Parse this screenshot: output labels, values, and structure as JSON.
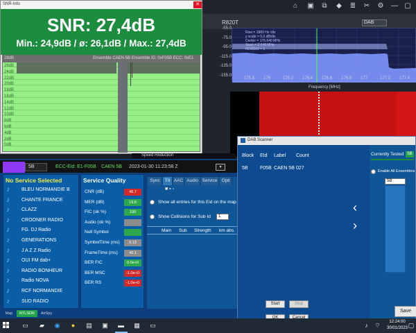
{
  "spectrum_window": {
    "title": "R820T",
    "select_value": "DAB",
    "legend": [
      "Rise = 3983 Hz /div",
      "y scale = 5.0 dB/div",
      "Center = 176.640 MHz",
      "Span = 2.048 MHz",
      "NOMSW = 1"
    ],
    "y_ticks": [
      "-55.0",
      "-75.0",
      "-95.0",
      "-115.0",
      "-135.0",
      "-155.0"
    ],
    "x_ticks": [
      "175.8",
      "176",
      "176.2",
      "176.4",
      "176.6",
      "176.8",
      "177",
      "177.2",
      "177.4"
    ],
    "x_label": "Frequency [MHz]"
  },
  "snr_window": {
    "title": "SNR-Info",
    "close": "✕",
    "snr_text": "SNR: 27,4dB",
    "stats_text": "Min.: 24,9dB / ø: 26,1dB / Max.: 27,4dB",
    "graph_header_left": "28dB",
    "graph_header_right": "Ensemble CAEN 5B  Ensemble ID: 0xF05B  ECC: 0xE1",
    "grid_labels": [
      "26dB",
      "24dB",
      "22dB",
      "20dB",
      "18dB",
      "16dB",
      "14dB",
      "12dB",
      "10dB",
      "8dB",
      "6dB",
      "4dB",
      "2dB",
      "0dB"
    ]
  },
  "speed_reduction": "Speed Reduction",
  "dab_app": {
    "channel": "5B",
    "ecc_text": "ECC-Eid: E1-F05B",
    "ensemble_text": "CAEN 5B",
    "datetime_text": "2023-01-30  11:23:58 Z",
    "dropdown_glyph": "▾",
    "no_service": "No Service Selected",
    "services": [
      "BLEU NORMANDIE B",
      "CHANTE FRANCE",
      "CLAZZ",
      "CROONER RADIO",
      "FG. DJ Radio",
      "GENERATIONS",
      "J A Z Z Radio",
      "OUI FM dab+",
      "RADIO BONHEUR",
      "Radio NOVA",
      "RCF NORMANDIE",
      "SUD RADIO"
    ],
    "quality_title": "Service Quality",
    "quality": [
      {
        "label": "CNR (dB)",
        "value": "46.7",
        "color": "#d22a2a"
      },
      {
        "label": "MER (dB)",
        "value": "19.8",
        "color": "#2da84c"
      },
      {
        "label": "FIC (ok %)",
        "value": "100",
        "color": "#2da84c"
      },
      {
        "label": "Audio (ok %)",
        "value": "",
        "color": "#8c8c8c"
      },
      {
        "label": "Null Symbol",
        "value": "",
        "color": "#2da84c"
      },
      {
        "label": "SymbolTime (ms)",
        "value": "0.13",
        "color": "#8c8c8c"
      },
      {
        "label": "FrameTime (ms)",
        "value": "40.1",
        "color": "#8c8c8c"
      },
      {
        "label": "BER FIC",
        "value": "0.0e+0",
        "color": "#2da84c"
      },
      {
        "label": "BER MSC",
        "value": "-1.0e+0",
        "color": "#d22a2a"
      },
      {
        "label": "BER RS",
        "value": "-1.0e+0",
        "color": "#d22a2a"
      }
    ],
    "tabs": [
      "Sync",
      "TII",
      "AAC",
      "Audio",
      "Service",
      "Opti"
    ],
    "tab_toolbar": "■  ▪  ▫",
    "show_all_text": "Show all entries for this Eid on the map",
    "show_collisions_text": "Show Collisions for Sub Id",
    "collision_value": "1",
    "columns": [
      "Main",
      "Sub",
      "Strength",
      "km abs."
    ],
    "bottom_tabs": [
      "Map",
      "RTLSDR",
      "AirSpy"
    ]
  },
  "scanner": {
    "title": "DAB Scanner",
    "headers": [
      "Block",
      "EId",
      "Label",
      "Count"
    ],
    "row": [
      "5B",
      "F05B",
      "CAEN 5B",
      "027"
    ],
    "currently_tested": "Currently Tested",
    "currently_tested_value": "5B",
    "enable_all": "Enable All Ensembles",
    "input_value": "5B",
    "start": "Start",
    "stop": "Stop",
    "ok": "OK",
    "cancel": "Cancel",
    "save": "Save"
  },
  "taskbar": {
    "time": "12:24:00",
    "date": "30/01/2023"
  }
}
